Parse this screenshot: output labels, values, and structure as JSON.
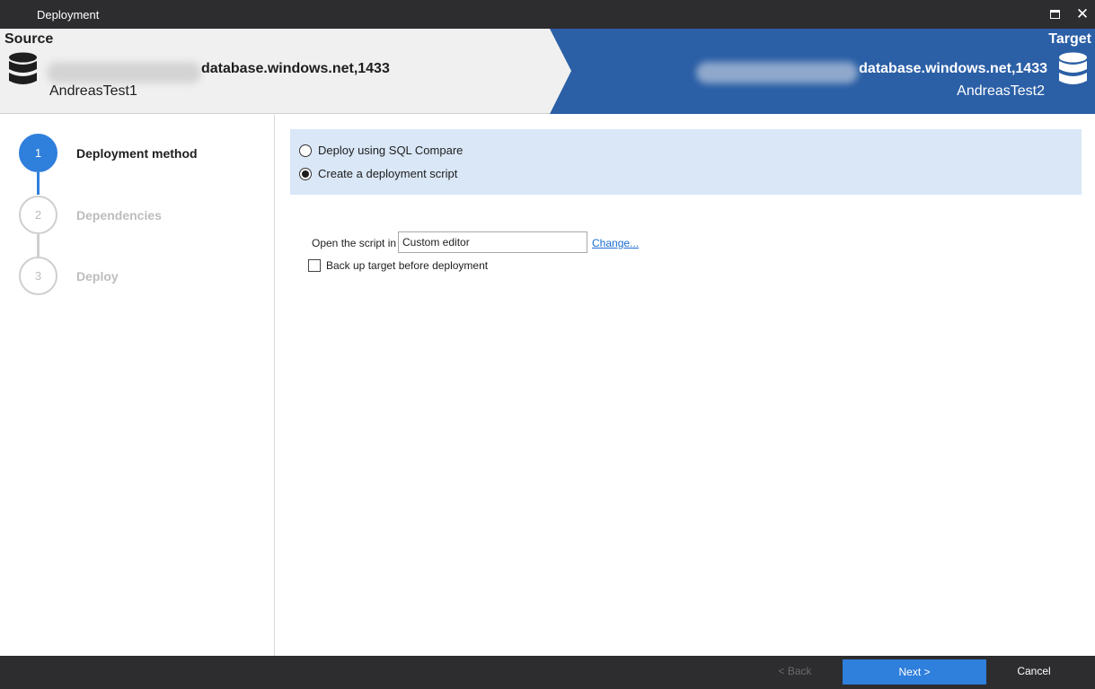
{
  "window": {
    "title": "Deployment",
    "maximize_icon": "maximize-icon",
    "close_icon": "close-icon",
    "close_glyph": "✕"
  },
  "source": {
    "label": "Source",
    "server": "database.windows.net,1433",
    "database": "AndreasTest1",
    "icon": "database-icon"
  },
  "target": {
    "label": "Target",
    "server": "database.windows.net,1433",
    "database": "AndreasTest2",
    "icon": "database-icon",
    "color": "#2b5fa6"
  },
  "steps": [
    {
      "number": "1",
      "label": "Deployment method",
      "state": "active"
    },
    {
      "number": "2",
      "label": "Dependencies",
      "state": "inactive"
    },
    {
      "number": "3",
      "label": "Deploy",
      "state": "inactive"
    }
  ],
  "method": {
    "options": [
      {
        "label": "Deploy using SQL Compare",
        "selected": false
      },
      {
        "label": "Create a deployment script",
        "selected": true
      }
    ]
  },
  "script": {
    "open_label": "Open the script in",
    "editor_value": "Custom editor",
    "change_link": "Change...",
    "backup_label": "Back up target before deployment",
    "backup_checked": false
  },
  "footer": {
    "back_label": "< Back",
    "next_label": "Next >",
    "cancel_label": "Cancel"
  },
  "colors": {
    "accent": "#2f7fdc",
    "header_target": "#2b5fa6",
    "options_background": "#d9e7f7",
    "chrome": "#2d2d30"
  }
}
